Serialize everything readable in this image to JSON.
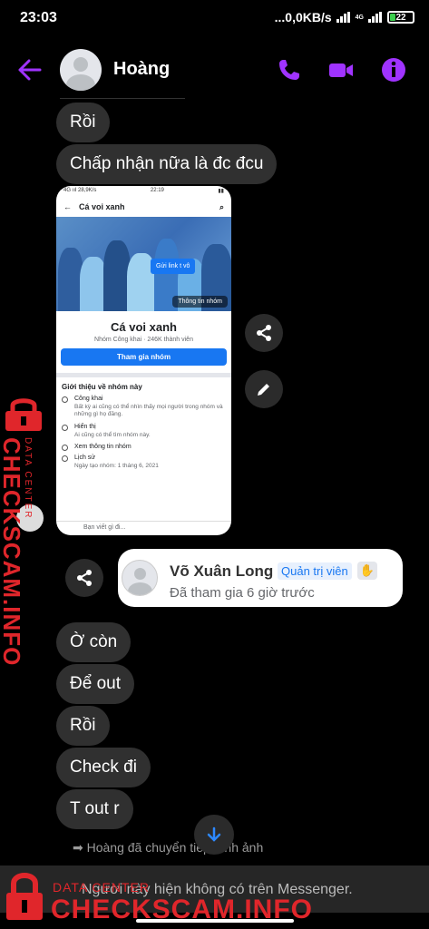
{
  "status_bar": {
    "time": "23:03",
    "network_speed": "...0,0KB/s",
    "network_type": "4G",
    "battery": "22"
  },
  "header": {
    "contact_name": "Hoàng"
  },
  "messages": [
    {
      "text": "Rồi"
    },
    {
      "text": "Chấp nhận nữa là đc đcu"
    },
    {
      "text": "Ờ còn"
    },
    {
      "text": "Để out"
    },
    {
      "text": "Rồi"
    },
    {
      "text": "Check đi"
    },
    {
      "text": "T out r"
    }
  ],
  "shared_screenshot": {
    "status_left": "4G ııl 28,9K/s",
    "status_time": "22:19",
    "nav_title": "Cá voi xanh",
    "banner_badge": "Gửi link t vô",
    "banner_info": "Thông tin nhóm",
    "group_name": "Cá voi xanh",
    "group_meta": "Nhóm Công khai · 246K thành viên",
    "join_button": "Tham gia nhóm",
    "about_title": "Giới thiệu về nhóm này",
    "rows": [
      {
        "title": "Công khai",
        "desc": "Bất kỳ ai cũng có thể nhìn thấy mọi người trong nhóm và những gì họ đăng."
      },
      {
        "title": "Hiển thị",
        "desc": "Ai cũng có thể tìm nhóm này."
      },
      {
        "title": "Xem thông tin nhóm",
        "desc": ""
      },
      {
        "title": "Lịch sử",
        "desc": "Ngày tạo nhóm: 1 tháng 6, 2021"
      }
    ],
    "post_placeholder": "Bạn viết gì đi..."
  },
  "member_card": {
    "name": "Võ Xuân Long",
    "role": "Quản trị viên",
    "joined": "Đã tham gia 6 giờ trước"
  },
  "forward_note": "Hoàng đã chuyển tiếp hình ảnh",
  "bottom_bar": {
    "text": "Người này hiện không có trên Messenger."
  },
  "watermark": {
    "small": "DATA CENTER",
    "big": "CHECKSCAM.INFO"
  },
  "colors": {
    "accent": "#a033ff",
    "bubble": "#303030",
    "background": "#000000",
    "watermark": "#e0262b"
  }
}
